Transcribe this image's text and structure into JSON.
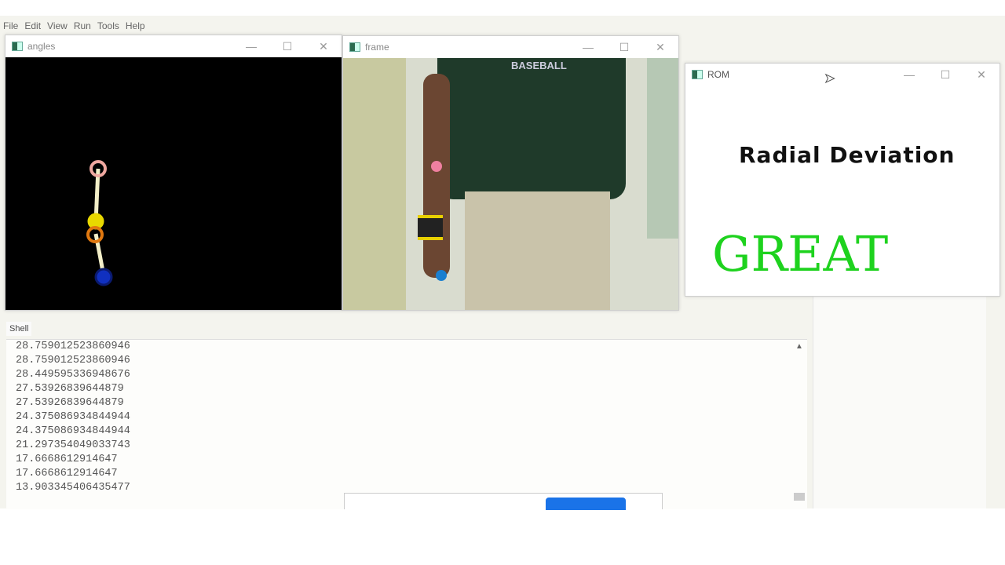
{
  "menu": [
    "File",
    "Edit",
    "View",
    "Run",
    "Tools",
    "Help"
  ],
  "windows": {
    "angles": {
      "title": "angles"
    },
    "frame": {
      "title": "frame",
      "shirt_text": "BASEBALL"
    },
    "rom": {
      "title": "ROM",
      "exercise": "Radial Deviation",
      "feedback": "GREAT",
      "feedback_color": "#1ed21e"
    }
  },
  "controls": {
    "minimize": "—",
    "maximize": "☐",
    "close": "✕"
  },
  "shell": {
    "tab": "Shell",
    "lines": [
      "28.759012523860946",
      "28.759012523860946",
      "28.449595336948676",
      "27.53926839644879",
      "27.53926839644879",
      "24.375086934844944",
      "24.375086934844944",
      "21.297354049033743",
      "17.6668612914647",
      "17.6668612914647",
      "13.903345406435477"
    ]
  }
}
